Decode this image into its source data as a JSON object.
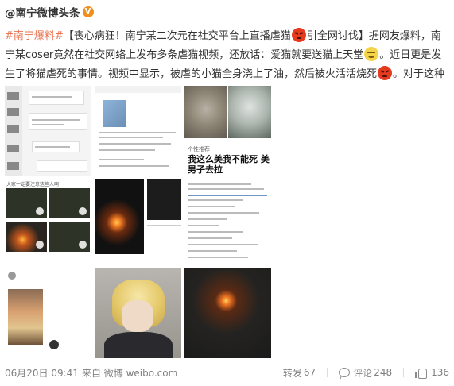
{
  "post": {
    "author": "@南宁微博头条",
    "verified_badge": "V",
    "topic": "#南宁爆料#",
    "text_part1": "【丧心病狂！南宁某二次元在社交平台上直播虐猫",
    "text_part2": "引全网讨伐】据网友爆料，南宁某coser竟然在社交网络上发布多条虐猫视频，还放话：爱猫就要送猫上天堂",
    "text_part3": "。近日更是发生了将猫虐死的事情。视频中显示，被虐的小猫全身浇上了油，然后被火活活烧死",
    "text_part4": "。对于这种人，你想说?",
    "images": {
      "cat_caption_label": "个性推荐",
      "cat_caption": "我这么美我不能死 美男子去拉",
      "video_header": "大家一定要注意这些人啊"
    },
    "footer": {
      "time": "06月20日 09:41",
      "source": "来自 微博 weibo.com",
      "repost_label": "转发",
      "repost_count": "67",
      "comment_label": "评论",
      "comment_count": "248",
      "like_count": "136"
    },
    "colors": {
      "topic": "#eb7350",
      "text": "#333333",
      "meta": "#808080",
      "verified": "#f08f1d"
    },
    "icons": [
      "comment-icon",
      "like-icon",
      "angry-emoji",
      "smirk-emoji",
      "verified-icon"
    ]
  }
}
